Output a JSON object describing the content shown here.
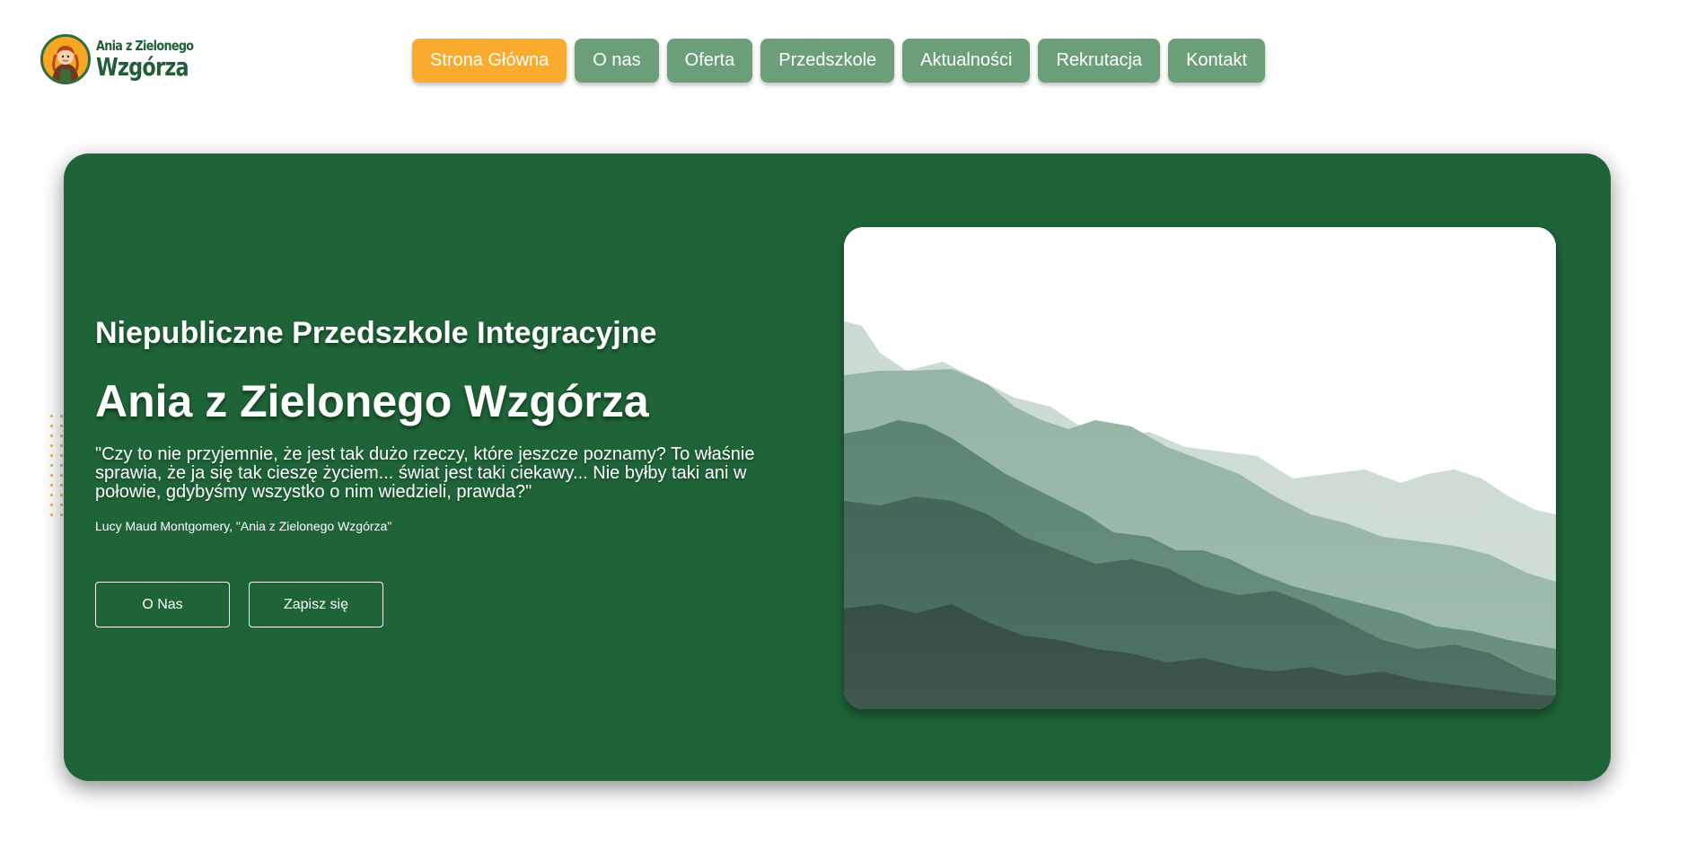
{
  "logo": {
    "line1": "Ania z Zielonego",
    "line2": "Wzgórza",
    "icon": "girl-avatar-icon"
  },
  "nav": {
    "items": [
      {
        "label": "Strona Główna",
        "active": true
      },
      {
        "label": "O nas"
      },
      {
        "label": "Oferta"
      },
      {
        "label": "Przedszkole"
      },
      {
        "label": "Aktualności"
      },
      {
        "label": "Rekrutacja"
      },
      {
        "label": "Kontakt"
      }
    ]
  },
  "hero": {
    "subtitle": "Niepubliczne Przedszkole Integracyjne",
    "title": "Ania z Zielonego Wzgórza",
    "quote": "\"Czy to nie przyjemnie, że jest tak dużo rzeczy, które jeszcze poznamy? To właśnie sprawia, że ja się tak cieszę życiem... świat jest taki ciekawy... Nie byłby taki ani w połowie, gdybyśmy wszystko o nim wiedzieli, prawda?\"",
    "quote_author": "Lucy Maud Montgomery, \"Ania z Zielonego Wzgórza\"",
    "button_about": "O Nas",
    "button_signup": "Zapisz się",
    "image": "misty-mountains-illustration"
  },
  "colors": {
    "hero_bg": "#1f6438",
    "nav_button": "#6a9f7a",
    "nav_active": "#f9ab2d",
    "accent_dots": "#e9a43a"
  }
}
